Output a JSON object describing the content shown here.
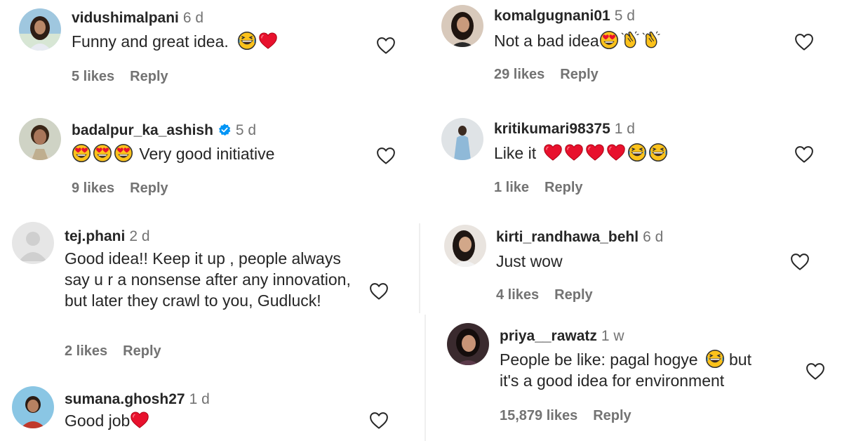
{
  "comments": [
    {
      "username": "vidushimalpani",
      "time": "6 d",
      "text_before": "Funny and great idea.",
      "text_after": "",
      "emojis": [
        "laughing-crying-emoji",
        "red-heart-emoji"
      ],
      "likes": "5 likes",
      "reply": "Reply"
    },
    {
      "username": "badalpur_ka_ashish",
      "time": "5 d",
      "verified": true,
      "text_before": "",
      "text_after": "Very good initiative",
      "emojis": [
        "heart-eyes-emoji",
        "heart-eyes-emoji",
        "heart-eyes-emoji"
      ],
      "likes": "9 likes",
      "reply": "Reply"
    },
    {
      "username": "tej.phani",
      "time": "2 d",
      "text": "Good idea!! Keep it up , people always say u r a nonsense after any innovation, but later they crawl to you, Gudluck!",
      "likes": "2 likes",
      "reply": "Reply"
    },
    {
      "username": "sumana.ghosh27",
      "time": "1 d",
      "text_before": "Good job",
      "text_after": "",
      "emojis": [
        "red-heart-emoji"
      ]
    },
    {
      "username": "komalgugnani01",
      "time": "5 d",
      "text_before": "Not a bad idea",
      "text_after": "",
      "emojis": [
        "heart-eyes-emoji",
        "clapping-hands-emoji",
        "clapping-hands-emoji"
      ],
      "likes": "29 likes",
      "reply": "Reply"
    },
    {
      "username": "kritikumari98375",
      "time": "1 d",
      "text_before": "Like it",
      "text_after": "",
      "emojis": [
        "red-heart-emoji",
        "red-heart-emoji",
        "red-heart-emoji",
        "red-heart-emoji",
        "laughing-crying-emoji",
        "laughing-crying-emoji"
      ],
      "likes": "1 like",
      "reply": "Reply"
    },
    {
      "username": "kirti_randhawa_behl",
      "time": "6 d",
      "text": "Just wow",
      "likes": "4 likes",
      "reply": "Reply"
    },
    {
      "username": "priya__rawatz",
      "time": "1 w",
      "line1_before": "People be like: pagal hogye",
      "line1_after": "but",
      "line1_emojis": [
        "laughing-crying-emoji"
      ],
      "line2": "it's a good idea for environment",
      "likes": "15,879 likes",
      "reply": "Reply"
    }
  ],
  "colors": {
    "text": "#262626",
    "muted": "#737373",
    "heart_emoji": "#e8112d",
    "emoji_yellow": "#fcc21b",
    "verified_blue": "#0095f6"
  }
}
